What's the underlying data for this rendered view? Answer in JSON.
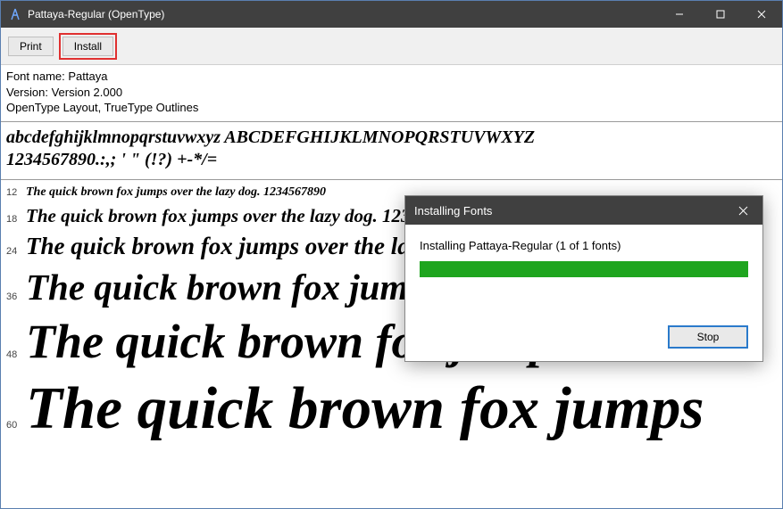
{
  "window": {
    "title": "Pattaya-Regular (OpenType)"
  },
  "toolbar": {
    "print_label": "Print",
    "install_label": "Install"
  },
  "meta": {
    "font_name_line": "Font name: Pattaya",
    "version_line": "Version: Version 2.000",
    "tech_line": "OpenType Layout, TrueType Outlines"
  },
  "specimen": {
    "alphabet_line": "abcdefghijklmnopqrstuvwxyz ABCDEFGHIJKLMNOPQRSTUVWXYZ",
    "symbols_line": "1234567890.:,; ' \" (!?) +-*/=",
    "pangram_full": "The quick brown fox jumps over the lazy dog. 1234567890",
    "sizes": {
      "s12": "12",
      "s18": "18",
      "s24": "24",
      "s36": "36",
      "s48": "48",
      "s60": "60"
    },
    "display": {
      "t12": "The quick brown fox jumps over the lazy dog. 1234567890",
      "t18": "The quick brown fox jumps over the lazy dog. 1234567890",
      "t24": "The quick brown fox jumps over the lazy dog. 1234567890",
      "t36": "The quick brown fox jumps over the lazy dog.",
      "t48": "The quick brown fox jumps over the",
      "t60": "The quick brown fox jumps"
    }
  },
  "dialog": {
    "title": "Installing Fonts",
    "message": "Installing Pattaya-Regular (1 of 1 fonts)",
    "stop_label": "Stop",
    "progress_percent": 100
  }
}
